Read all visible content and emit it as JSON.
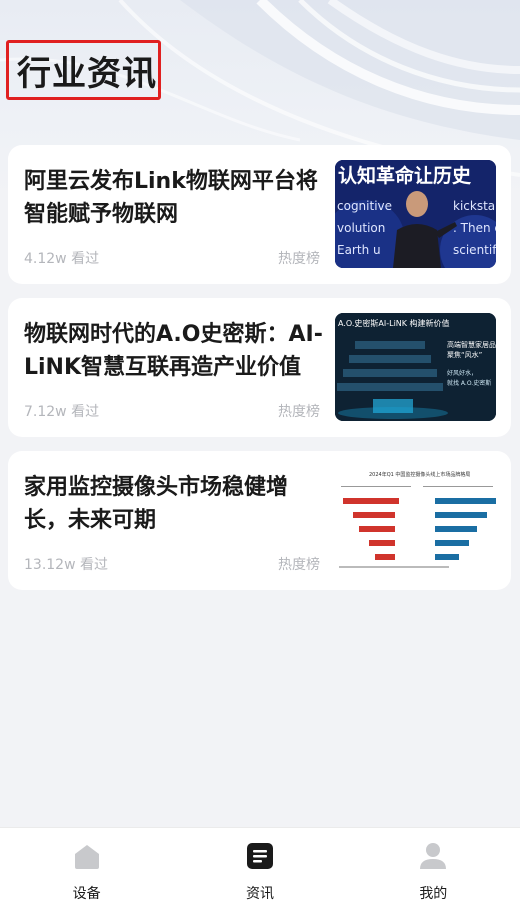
{
  "page": {
    "title": "行业资讯"
  },
  "news": [
    {
      "title": "阿里云发布Link物联网平台将智能赋予物联网",
      "views": "4.12w 看过",
      "tag": "热度榜",
      "thumb_caption": "认知革命让历史",
      "thumb_text_lines": [
        "cognitive",
        "kickstart",
        "volution",
        ". Then c",
        "Earth u",
        "scientif"
      ]
    },
    {
      "title": "物联网时代的A.O史密斯：AI-LiNK智慧互联再造产业价值",
      "views": "7.12w 看过",
      "tag": "热度榜",
      "thumb_caption": "A.O.史密斯AI-LiNK 构建新价值",
      "thumb_side_text": [
        "高端智慧家居品",
        "聚焦“风水”",
        "好风好水，",
        "就找 A.O.史密斯"
      ]
    },
    {
      "title": "家用监控摄像头市场稳健增长，未来可期",
      "views": "13.12w 看过",
      "tag": "热度榜",
      "thumb_caption": "2024年Q1 中国监控摄像头线上市场品牌格局"
    }
  ],
  "tabbar": {
    "items": [
      {
        "label": "设备",
        "icon": "home-icon",
        "active": false
      },
      {
        "label": "资讯",
        "icon": "news-icon",
        "active": true
      },
      {
        "label": "我的",
        "icon": "user-icon",
        "active": false
      }
    ]
  },
  "colors": {
    "background": "#f2f3f6",
    "card": "#ffffff",
    "title": "#1a1a1a",
    "meta": "#b4b6bb",
    "highlight_border": "#e02020",
    "tab_active": "#1a1a1a",
    "tab_inactive": "#c8c9cc"
  }
}
